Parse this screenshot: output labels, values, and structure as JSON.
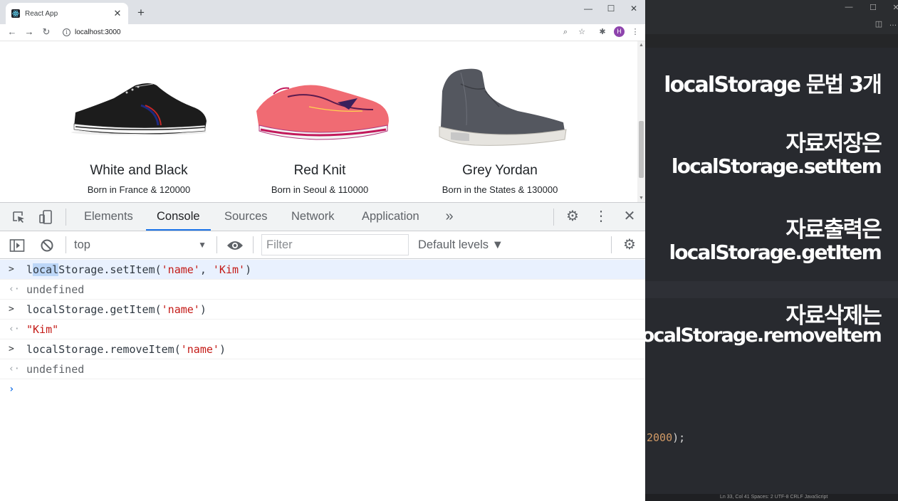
{
  "browser": {
    "tab_title": "React App",
    "tab_close": "✕",
    "new_tab": "+",
    "url": "localhost:3000",
    "profile_initial": "H",
    "window_controls": {
      "minimize": "—",
      "maximize": "☐",
      "close": "✕"
    }
  },
  "products": [
    {
      "name": "White and Black",
      "description": "Born in France & 120000"
    },
    {
      "name": "Red Knit",
      "description": "Born in Seoul & 110000"
    },
    {
      "name": "Grey Yordan",
      "description": "Born in the States & 130000"
    }
  ],
  "devtools": {
    "tabs": [
      "Elements",
      "Console",
      "Sources",
      "Network",
      "Application"
    ],
    "active_tab": "Console",
    "more_tabs": "»",
    "context": "top",
    "filter_placeholder": "Filter",
    "levels": "Default levels ▼",
    "console": [
      {
        "type": "input",
        "code": "localStorage.setItem('name', 'Kim')"
      },
      {
        "type": "output",
        "value": "undefined"
      },
      {
        "type": "input",
        "code": "localStorage.getItem('name')"
      },
      {
        "type": "output",
        "value": "\"Kim\""
      },
      {
        "type": "input",
        "code": "localStorage.removeItem('name')"
      },
      {
        "type": "output",
        "value": "undefined"
      }
    ],
    "prompt": "›"
  },
  "slide": {
    "title": "localStorage 문법 3개",
    "save_label": "자료저장은",
    "save_api": "localStorage.setItem",
    "get_label": "자료출력은",
    "get_api": "localStorage.getItem",
    "remove_label": "자료삭제는",
    "remove_api": "localStorage.removeItem",
    "code_fragment": "2000",
    "code_fragment_tail": ");",
    "statusbar": "Ln 33, Col 41    Spaces: 2    UTF-8    CRLF    JavaScript"
  }
}
